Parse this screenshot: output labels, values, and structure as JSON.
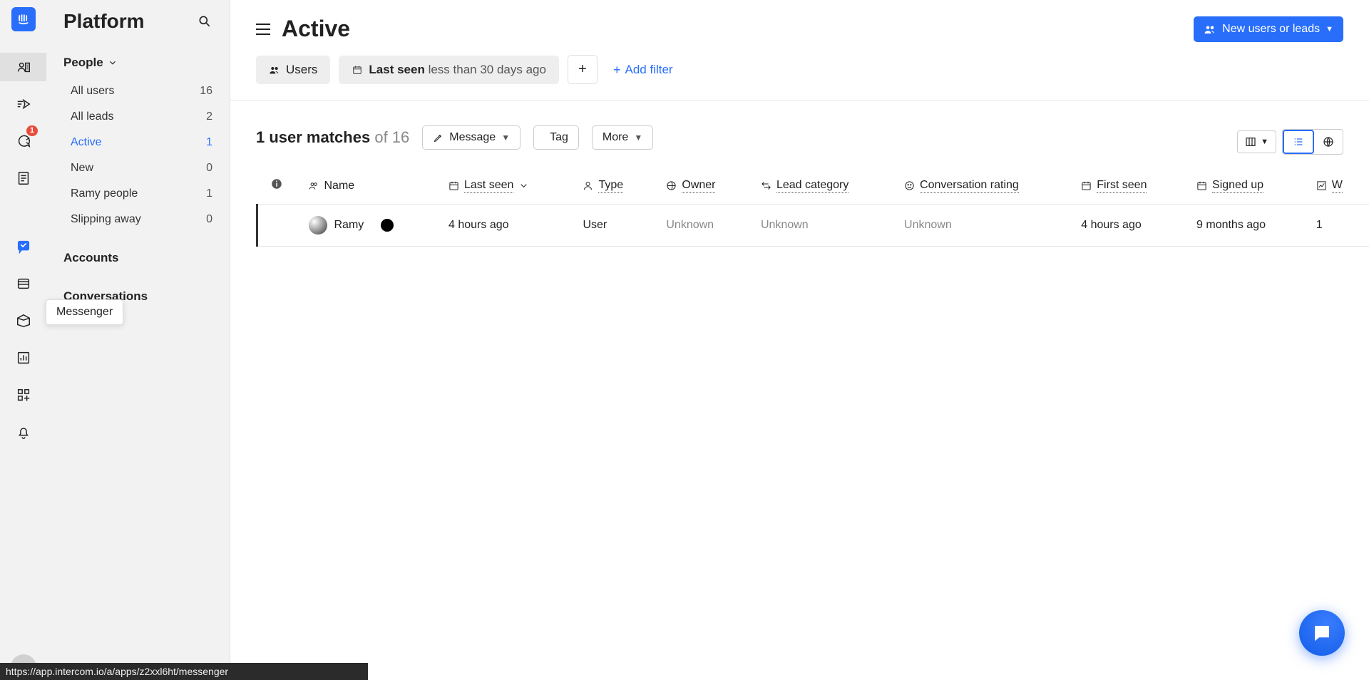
{
  "brand": {
    "name": "Intercom"
  },
  "sidebar2": {
    "title": "Platform",
    "section_people": "People",
    "items": [
      {
        "label": "All users",
        "count": "16"
      },
      {
        "label": "All leads",
        "count": "2"
      },
      {
        "label": "Active",
        "count": "1"
      },
      {
        "label": "New",
        "count": "0"
      },
      {
        "label": "Ramy people",
        "count": "1"
      },
      {
        "label": "Slipping away",
        "count": "0"
      }
    ],
    "section_accounts": "Accounts",
    "section_conversations": "Conversations"
  },
  "rail": {
    "conversations_badge": "1",
    "tooltip": "Messenger"
  },
  "header": {
    "page_title": "Active",
    "new_button": "New users or leads"
  },
  "filters": {
    "users_chip": "Users",
    "last_seen_label": "Last seen",
    "last_seen_value": "less than 30 days ago",
    "add_filter": "Add filter"
  },
  "toolbar": {
    "matches_strong": "1 user matches",
    "matches_of": "of 16",
    "message": "Message",
    "tag": "Tag",
    "more": "More"
  },
  "columns": {
    "name": "Name",
    "last_seen": "Last seen",
    "type": "Type",
    "owner": "Owner",
    "lead_category": "Lead category",
    "conversation_rating": "Conversation rating",
    "first_seen": "First seen",
    "signed_up": "Signed up",
    "web_sessions": "W"
  },
  "rows": [
    {
      "name": "Ramy",
      "last_seen": "4 hours ago",
      "type": "User",
      "owner": "Unknown",
      "lead_category": "Unknown",
      "conversation_rating": "Unknown",
      "first_seen": "4 hours ago",
      "signed_up": "9 months ago",
      "web_sessions": "1"
    }
  ],
  "status_url": "https://app.intercom.io/a/apps/z2xxl6ht/messenger"
}
